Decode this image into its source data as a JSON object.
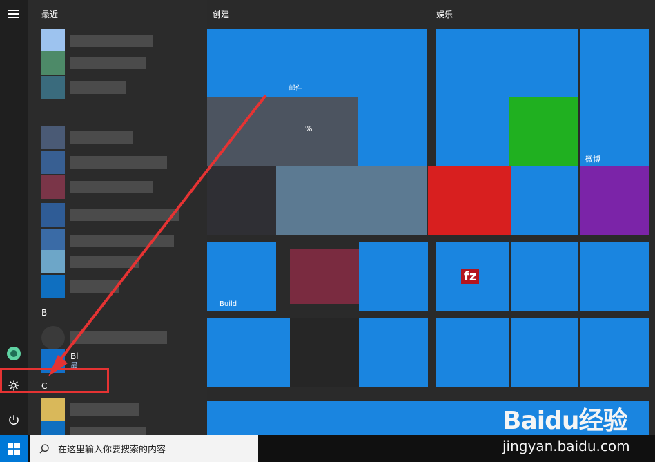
{
  "start_menu": {
    "rail": {
      "user_icon": "user-avatar-icon",
      "settings_icon": "gear-icon",
      "power_icon": "power-icon",
      "menu_icon": "hamburger-icon"
    },
    "app_list": {
      "header_recent": "最近",
      "section_b": "B",
      "section_c": "C",
      "apps": [
        {
          "label": "Bl"
        },
        {
          "label": "最"
        }
      ]
    },
    "groups": [
      {
        "title": "创建"
      },
      {
        "title": "娱乐"
      }
    ],
    "tiles": [
      {
        "label": "邮件"
      },
      {
        "label": "%"
      },
      {
        "label": "微博"
      },
      {
        "label": "Build"
      },
      {
        "label": "fz"
      }
    ]
  },
  "taskbar": {
    "search_placeholder": "在这里输入你要搜索的内容",
    "windows_icon": "windows-logo-icon",
    "search_icon": "search-icon",
    "mic_icon": "microphone-icon"
  },
  "annotation": {
    "arrow_color": "#e53333",
    "highlight_color": "#e53333"
  },
  "watermark": {
    "logo_text": "Baidu经验",
    "url_text": "jingyan.baidu.com"
  }
}
